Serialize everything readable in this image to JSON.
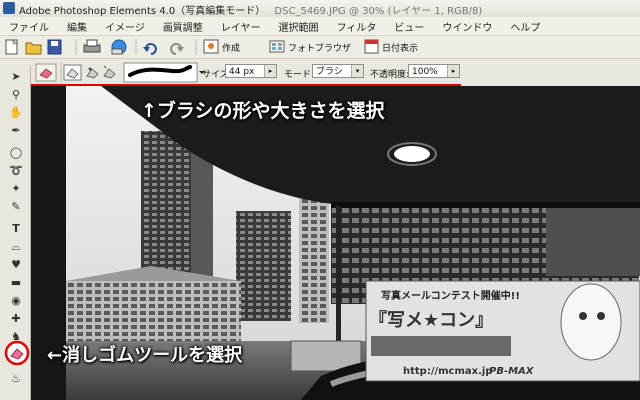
{
  "titlebar": {
    "app_title": "Adobe Photoshop Elements 4.0（写真編集モード）",
    "doc_title": "DSC_5469.JPG @ 30% (レイヤー 1, RGB/8)"
  },
  "menu": [
    "ファイル",
    "編集",
    "イメージ",
    "画質調整",
    "レイヤー",
    "選択範囲",
    "フィルタ",
    "ビュー",
    "ウインドウ",
    "ヘルプ"
  ],
  "shortcuts": {
    "create_label": "作成",
    "photo_browser_label": "フォトブラウザ",
    "date_view_label": "日付表示"
  },
  "options": {
    "size_label": "サイズ:",
    "size_value": "44 px",
    "mode_label": "モード:",
    "mode_value": "ブラシ",
    "opacity_label": "不透明度:",
    "opacity_value": "100%"
  },
  "callouts": {
    "brush_callout": "↑ブラシの形や大きさを選択",
    "eraser_callout": "←消しゴムツールを選択"
  },
  "photo": {
    "banner_line1": "写真メールコンテスト開催中!!",
    "banner_line2": "『写メ★コン』",
    "banner_url": "http://mcmax.jp",
    "banner_brand": "PB-MAX"
  },
  "colors": {
    "callout_ring": "#e00000",
    "underline": "#e00000"
  }
}
